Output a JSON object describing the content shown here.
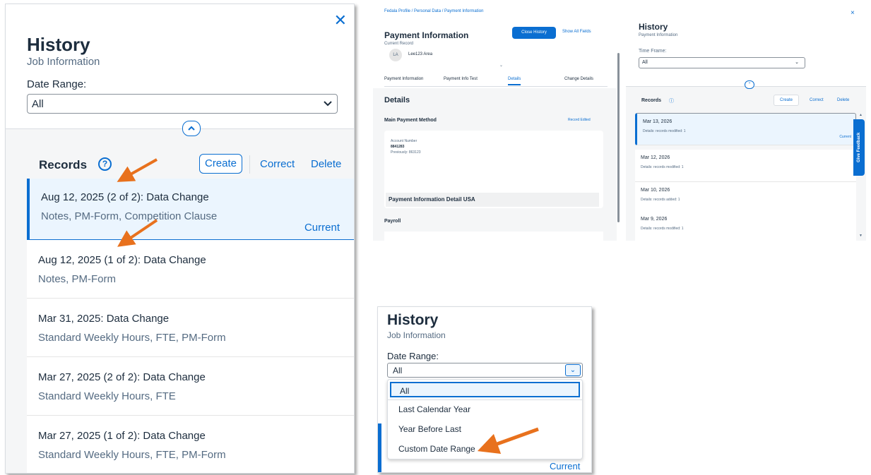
{
  "panel1": {
    "close_icon": "close-icon",
    "title": "History",
    "subtitle": "Job Information",
    "date_range_label": "Date Range:",
    "date_range_value": "All",
    "records_title": "Records",
    "help_glyph": "?",
    "create_label": "Create",
    "correct_label": "Correct",
    "delete_label": "Delete",
    "records": [
      {
        "title": "Aug 12, 2025 (2 of 2): Data Change",
        "subtitle": "Notes, PM-Form, Competition Clause",
        "current": "Current"
      },
      {
        "title": "Aug 12, 2025 (1 of 2): Data Change",
        "subtitle": "Notes, PM-Form"
      },
      {
        "title": "Mar 31, 2025: Data Change",
        "subtitle": "Standard Weekly Hours, FTE, PM-Form"
      },
      {
        "title": "Mar 27, 2025 (2 of 2): Data Change",
        "subtitle": "Standard Weekly Hours, FTE"
      },
      {
        "title": "Mar 27, 2025 (1 of 2): Data Change",
        "subtitle": "Standard Weekly Hours, FTE, PM-Form"
      }
    ]
  },
  "panel2": {
    "breadcrumb": "Fedala Profile / Personal Data / Payment Information",
    "title": "Payment Information",
    "close_history": "Close History",
    "show_all": "Show All Fields",
    "current_record": "Current Record",
    "avatar": "LA",
    "user": "Lee123 Area",
    "tabs": [
      "Payment Information",
      "Payment Info Test",
      "Details",
      "Change Details"
    ],
    "details": "Details",
    "main_payment": "Main Payment Method",
    "record_badge": "Record Edited",
    "account_label": "Account Number",
    "account_value": "8841283",
    "previous": "Previously: 863123",
    "detail_usa": "Payment Information Detail USA",
    "payroll": "Payroll"
  },
  "panel3": {
    "close": "×",
    "title": "History",
    "subtitle": "Payment Information",
    "time_frame_label": "Time Frame:",
    "time_frame_value": "All",
    "records_title": "Records",
    "create": "Create",
    "correct": "Correct",
    "delete": "Delete",
    "feedback": "Give Feedback",
    "records": [
      {
        "title": "Mar 13, 2026",
        "subtitle": "Details: records modified: 1",
        "current": "Current"
      },
      {
        "title": "Mar 12, 2026",
        "subtitle": "Details: records modified: 1"
      },
      {
        "title": "Mar 10, 2026",
        "subtitle": "Details: records added: 1"
      },
      {
        "title": "Mar 9, 2026",
        "subtitle": "Details: records modified: 1"
      }
    ]
  },
  "panel4": {
    "title": "History",
    "subtitle": "Job Information",
    "date_range_label": "Date Range:",
    "date_range_value": "All",
    "options": [
      "All",
      "Last Calendar Year",
      "Year Before Last",
      "Custom Date Range"
    ],
    "current": "Current"
  },
  "colors": {
    "accent": "#0a6ed1",
    "arrow": "#e8711d",
    "text": "#1d2d3e",
    "muted": "#556b82"
  }
}
